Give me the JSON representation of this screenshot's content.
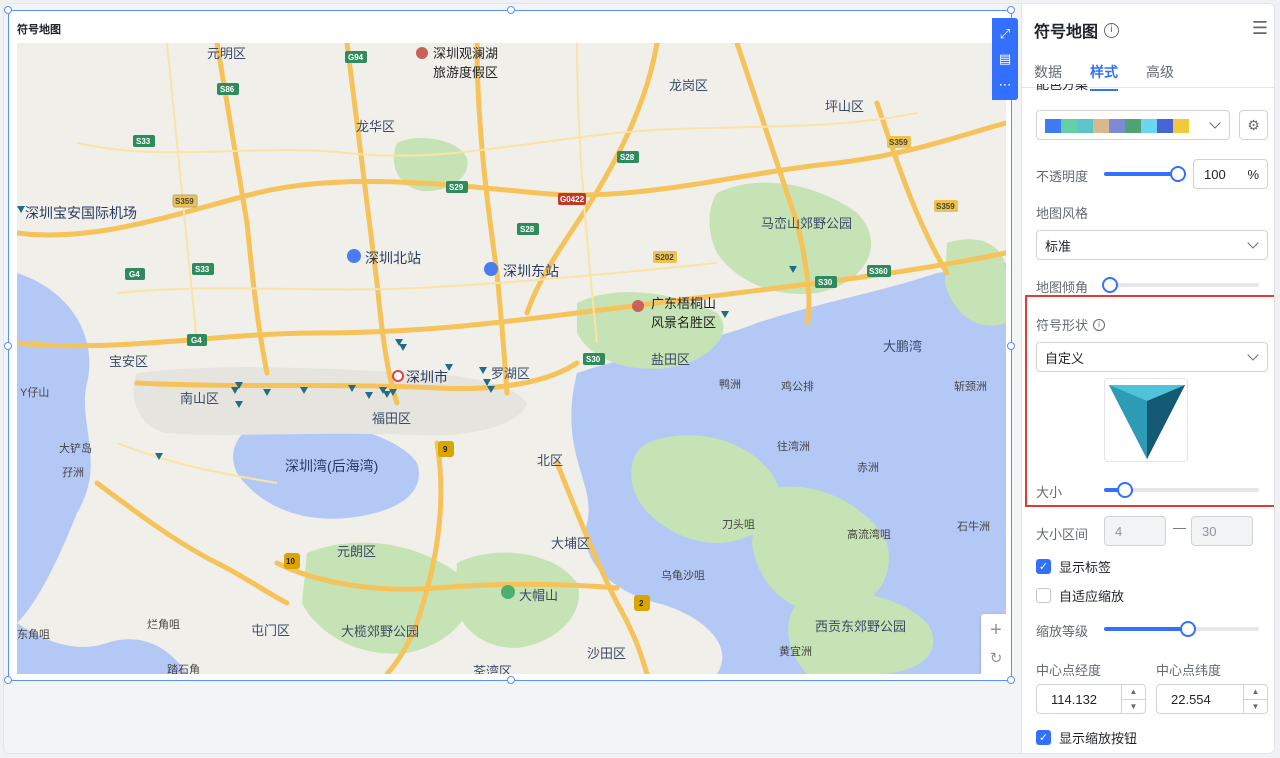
{
  "widget": {
    "title": "符号地图",
    "map_labels": [
      {
        "text": "深圳观澜湖旅游度假区",
        "line1": "深圳观澜湖",
        "line2": "旅游度假区"
      },
      {
        "text": "元明区"
      },
      {
        "text": "龙华区"
      },
      {
        "text": "龙岗区"
      },
      {
        "text": "坪山区"
      },
      {
        "text": "深圳宝安国际机场"
      },
      {
        "text": "深圳北站"
      },
      {
        "text": "深圳东站"
      },
      {
        "text": "马峦山郊野公园"
      },
      {
        "text": "广东梧桐山风景名胜区",
        "line1": "广东梧桐山",
        "line2": "风景名胜区"
      },
      {
        "text": "宝安区"
      },
      {
        "text": "盐田区"
      },
      {
        "text": "大鹏湾"
      },
      {
        "text": "罗湖区"
      },
      {
        "text": "深圳市"
      },
      {
        "text": "南山区"
      },
      {
        "text": "福田区"
      },
      {
        "text": "Y仔山"
      },
      {
        "text": "鸭洲"
      },
      {
        "text": "鸡公排"
      },
      {
        "text": "斩颈洲"
      },
      {
        "text": "大铲岛"
      },
      {
        "text": "孖洲"
      },
      {
        "text": "深圳湾(后海湾)"
      },
      {
        "text": "北区"
      },
      {
        "text": "往湾洲"
      },
      {
        "text": "赤洲"
      },
      {
        "text": "刀头咀"
      },
      {
        "text": "高流湾咀"
      },
      {
        "text": "石牛洲"
      },
      {
        "text": "元朗区"
      },
      {
        "text": "大埔区"
      },
      {
        "text": "大帽山"
      },
      {
        "text": "乌龟沙咀"
      },
      {
        "text": "东角咀"
      },
      {
        "text": "烂角咀"
      },
      {
        "text": "屯门区"
      },
      {
        "text": "大榄郊野公园"
      },
      {
        "text": "西贡东郊野公园"
      },
      {
        "text": "沙田区"
      },
      {
        "text": "黄宜洲"
      },
      {
        "text": "荃湾区"
      },
      {
        "text": "踏石角"
      }
    ],
    "road_badges": [
      "G94",
      "S86",
      "S33",
      "S359",
      "G4",
      "S33",
      "G4",
      "S29",
      "S28",
      "S28",
      "S202",
      "S360",
      "S30",
      "S359",
      "S359",
      "G0422",
      "S30",
      "9",
      "10",
      "2"
    ]
  },
  "panel": {
    "title": "符号地图",
    "tabs": [
      "数据",
      "样式",
      "高级"
    ],
    "active_tab": "样式",
    "color_scheme_label": "配色方案",
    "colors": [
      "#3f7bf2",
      "#62d0a4",
      "#5bc5c9",
      "#d9b98a",
      "#7d8ad6",
      "#4fa272",
      "#6ad7ef",
      "#4763d6",
      "#f2c93b"
    ],
    "opacity_label": "不透明度",
    "opacity_value": "100",
    "opacity_unit": "%",
    "opacity_pct": 1.0,
    "map_style_label": "地图风格",
    "map_style_value": "标准",
    "map_tilt_label": "地图倾角",
    "map_tilt_pct": 0.0,
    "symbol_shape_label": "符号形状",
    "symbol_shape_value": "自定义",
    "size_label": "大小",
    "size_pct": 0.12,
    "size_range_label": "大小区间",
    "size_min": "4",
    "size_range_sep": "—",
    "size_max": "30",
    "show_label": "显示标签",
    "show_label_checked": true,
    "adaptive_zoom": "自适应缩放",
    "adaptive_zoom_checked": false,
    "zoom_level_label": "缩放等级",
    "zoom_level_pct": 0.54,
    "center_lng_label": "中心点经度",
    "center_lat_label": "中心点纬度",
    "center_lng": "114.132",
    "center_lat": "22.554",
    "show_zoom_button": "显示缩放按钮",
    "show_zoom_button_checked": true
  }
}
